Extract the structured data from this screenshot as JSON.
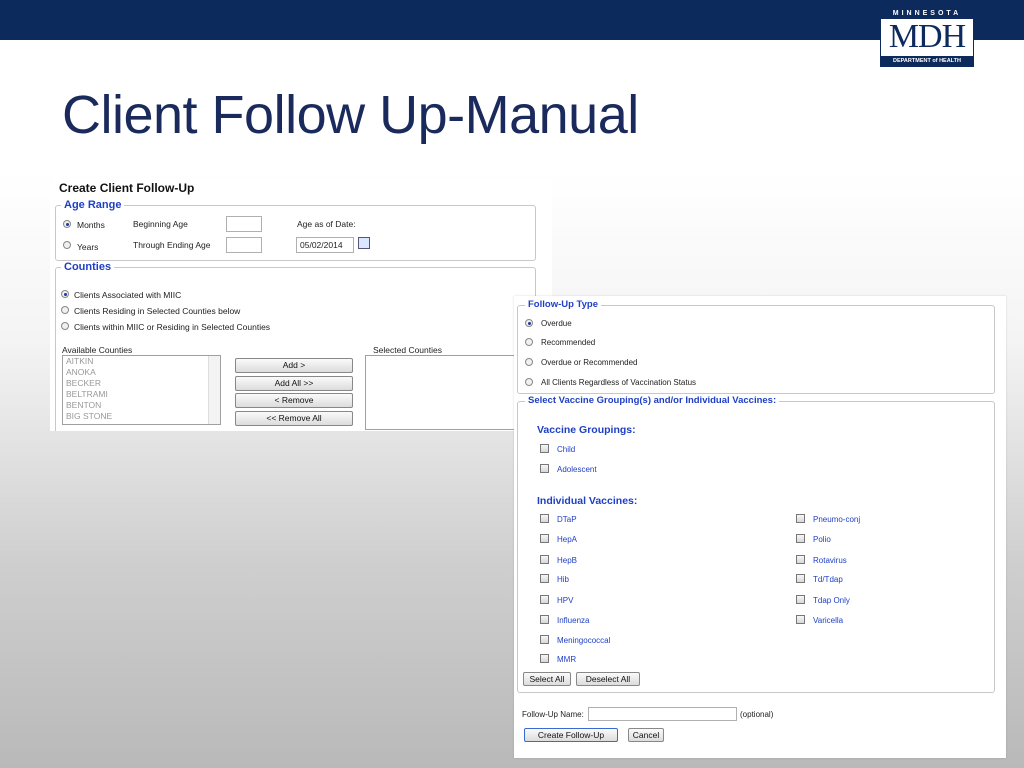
{
  "slide": {
    "title": "Client Follow Up-Manual",
    "logo": {
      "top": "MINNESOTA",
      "mid": "MDH",
      "bottom": "DEPARTMENT of HEALTH"
    }
  },
  "create_panel": {
    "title": "Create Client Follow-Up",
    "age_range": {
      "legend": "Age Range",
      "months_label": "Months",
      "years_label": "Years",
      "months_selected": true,
      "beginning_age_label": "Beginning Age",
      "through_age_label": "Through Ending Age",
      "beginning_age_value": "",
      "through_age_value": "",
      "age_as_of_label": "Age as of Date:",
      "age_as_of_value": "05/02/2014"
    },
    "counties": {
      "legend": "Counties",
      "options": [
        "Clients Associated with MIIC",
        "Clients Residing in Selected Counties below",
        "Clients within MIIC or Residing in Selected Counties"
      ],
      "selected_index": 0,
      "available_label": "Available Counties",
      "selected_label": "Selected Counties",
      "available": [
        "AITKIN",
        "ANOKA",
        "BECKER",
        "BELTRAMI",
        "BENTON",
        "BIG STONE"
      ],
      "buttons": {
        "add": "Add >",
        "add_all": "Add All >>",
        "remove": "< Remove",
        "remove_all": "<< Remove All"
      }
    }
  },
  "followup_panel": {
    "type_legend": "Follow-Up Type",
    "type_options": [
      "Overdue",
      "Recommended",
      "Overdue or Recommended",
      "All Clients Regardless of Vaccination Status"
    ],
    "type_selected_index": 0,
    "vaccine_legend": "Select Vaccine Grouping(s) and/or Individual Vaccines:",
    "groupings_header": "Vaccine Groupings:",
    "groupings": [
      "Child",
      "Adolescent"
    ],
    "individual_header": "Individual Vaccines:",
    "vaccines_col1": [
      "DTaP",
      "HepA",
      "HepB",
      "Hib",
      "HPV",
      "Influenza",
      "Meningococcal",
      "MMR"
    ],
    "vaccines_col2": [
      "Pneumo-conj",
      "Polio",
      "Rotavirus",
      "Td/Tdap",
      "Tdap Only",
      "Varicella"
    ],
    "select_all": "Select All",
    "deselect_all": "Deselect All",
    "name_label": "Follow-Up Name:",
    "name_value": "",
    "optional_label": "(optional)",
    "create_button": "Create Follow-Up",
    "cancel_button": "Cancel"
  }
}
